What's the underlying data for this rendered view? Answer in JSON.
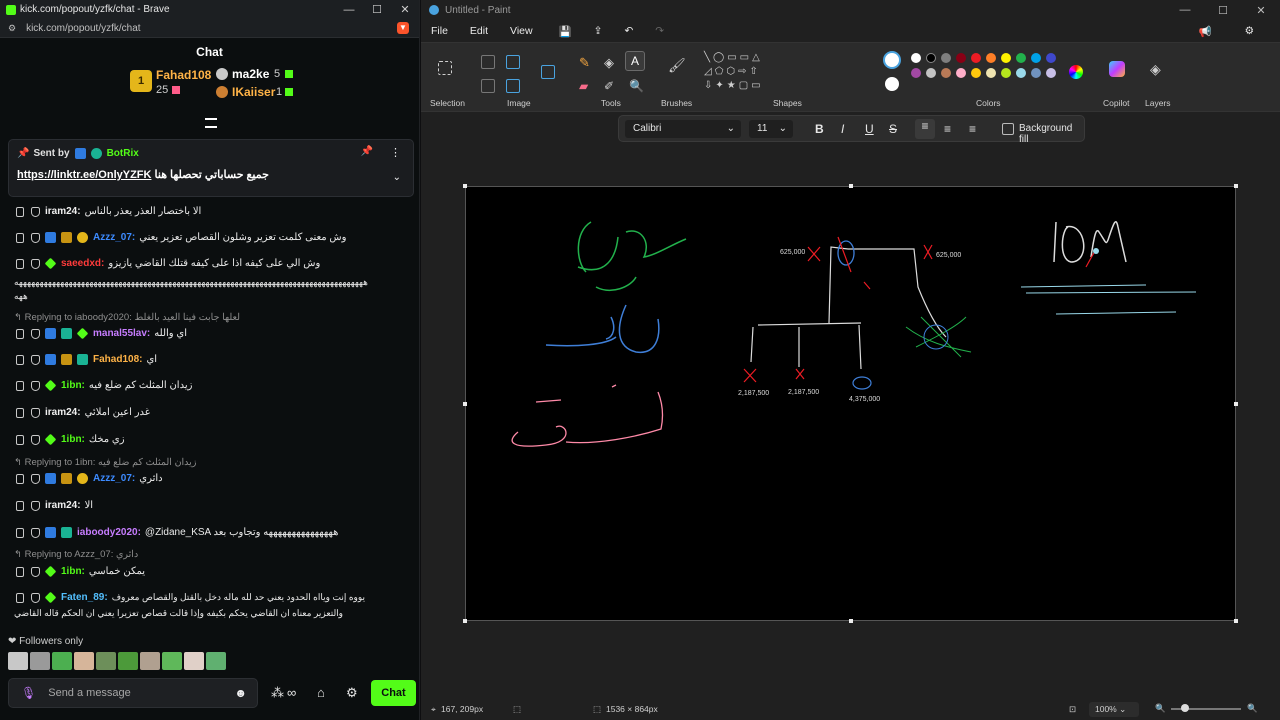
{
  "browser": {
    "title": "kick.com/popout/yzfk/chat - Brave",
    "url": "kick.com/popout/yzfk/chat"
  },
  "chat": {
    "header": "Chat",
    "leaderboard": {
      "first": {
        "rank": "1",
        "name": "Fahad108",
        "count": "25"
      },
      "second": {
        "name": "ma2ke",
        "count": "5"
      },
      "third": {
        "name": "IKaiiser",
        "count": "1"
      }
    },
    "pinned": {
      "sent_by": "Sent by",
      "sender": "BotRix",
      "text": "جميع حساباتي تحصلها هنا",
      "link": "https://linktr.ee/OnlyYZFK"
    },
    "messages": [
      {
        "user": "iram24:",
        "color": "#f0f0f0",
        "text": "الا باختصار العذر يعذر بالناس"
      },
      {
        "user": "Azzz_07:",
        "color": "#3d8bff",
        "text": "وش معنى كلمت تعزير وشلون القصاص تعزير يعني"
      },
      {
        "user": "saeedxd:",
        "color": "#ff3b3b",
        "text": "وش الي على كيفه اذا على كيفه قتلك القاضي يازيزو"
      },
      {
        "user": "manal55lav:",
        "color": "#c77dff",
        "text": "اي والله"
      },
      {
        "user": "Fahad108:",
        "color": "#ffb347",
        "text": "اي"
      },
      {
        "user": "1ibn:",
        "color": "#53fc18",
        "text": "زيدان المثلث كم ضلع فيه"
      },
      {
        "user": "iram24:",
        "color": "#f0f0f0",
        "text": "غدر اعين املائي"
      },
      {
        "user": "1ibn:",
        "color": "#53fc18",
        "text": "زي مخك"
      },
      {
        "user": "Azzz_07:",
        "color": "#3d8bff",
        "text": "داثري"
      },
      {
        "user": "iram24:",
        "color": "#f0f0f0",
        "text": "الا"
      },
      {
        "user": "iaboody2020:",
        "color": "#c77dff",
        "text": "@Zidane_KSA هههههههههههههههه وتجاوب بعد"
      },
      {
        "user": "1ibn:",
        "color": "#53fc18",
        "text": "يمكن خماسي"
      },
      {
        "user": "Faten_89:",
        "color": "#53c0ff",
        "text": "يووه إنت ويااه الحدود يعني حد لله ماله دخل بالقتل والقصاص معروف"
      }
    ],
    "overflow_line": "ههههههههههههههههههههههههههههههههههههههههههههههههههههههههههههههههههههههههههههههههههههه",
    "overflow_line2": "ههه",
    "last_line2": "والتعزير معناه ان القاضي يحكم بكيفه وإذا قالت قصاص تعزيرا يعني ان الحكم قاله القاضي",
    "replies": [
      {
        "label": "Replying to iaboody2020:",
        "quote": "لعلها جابت فينا العيد بالغلط"
      },
      {
        "label": "Replying to 1ibn:",
        "quote": "زيدان المثلث كم ضلع فيه"
      },
      {
        "label": "Replying to Azzz_07:",
        "quote": "داثري"
      }
    ],
    "followers_only": "Followers only",
    "input_placeholder": "Send a message",
    "send_button": "Chat"
  },
  "paint": {
    "title": "Untitled - Paint",
    "menu": [
      "File",
      "Edit",
      "View"
    ],
    "groups": [
      "Selection",
      "Image",
      "Tools",
      "Brushes",
      "Shapes",
      "Colors",
      "Copilot",
      "Layers"
    ],
    "font": "Calibri",
    "size": "11",
    "background_fill": "Background fill",
    "canvas_text": {
      "big_left": "625,000",
      "big_right": "625,000",
      "c1": "2,187,500",
      "c2": "2,187,500",
      "c3": "4,375,000"
    },
    "status": {
      "cursor": "167, 209px",
      "dimensions": "1536 × 864px",
      "zoom": "100%"
    },
    "palette": [
      "#ffffff",
      "#000000",
      "#7f7f7f",
      "#880015",
      "#ed1c24",
      "#ff7f27",
      "#fff200",
      "#22b14c",
      "#00a2e8",
      "#3f48cc",
      "#a349a4",
      "#c3c3c3",
      "#b97a57",
      "#ffaec9",
      "#ffc90e",
      "#efe4b0",
      "#b5e61d",
      "#99d9ea",
      "#7092be",
      "#c8bfe7"
    ]
  }
}
